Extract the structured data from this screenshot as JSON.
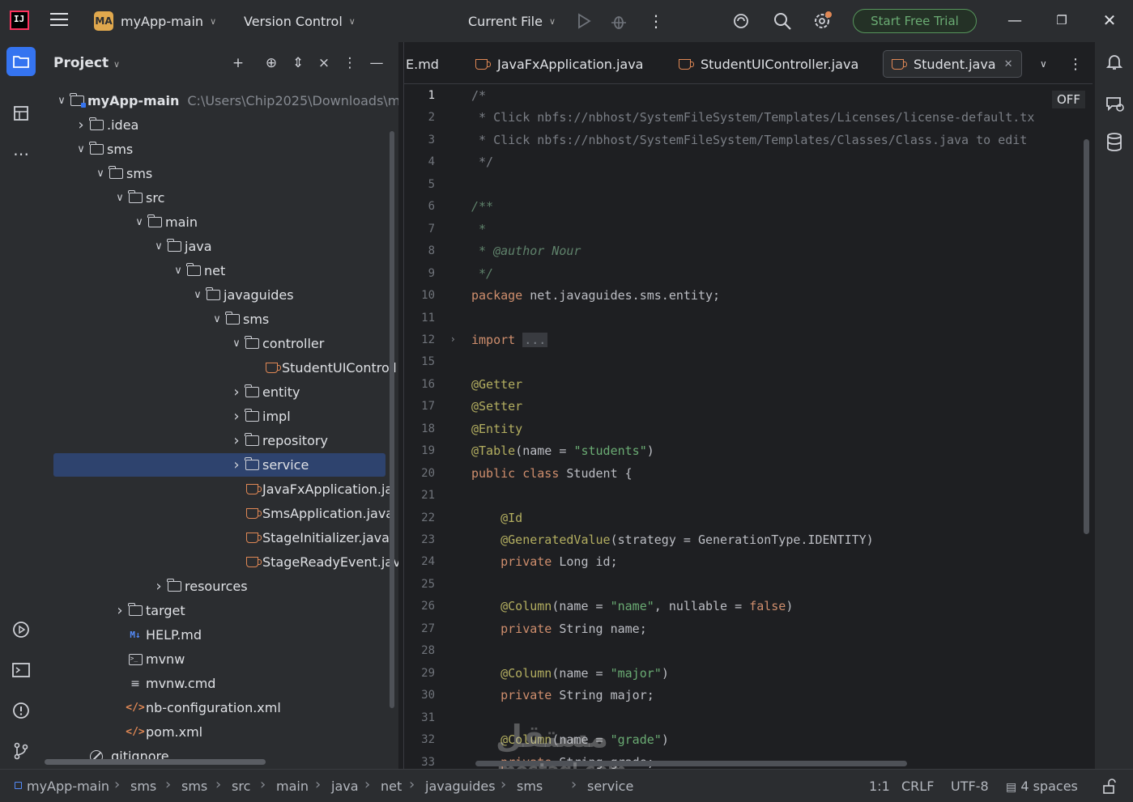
{
  "titlebar": {
    "project_badge": "MA",
    "project_name": "myApp-main",
    "vcs_label": "Version Control",
    "run_config": "Current File",
    "trial_label": "Start Free Trial"
  },
  "project_panel": {
    "title": "Project",
    "tree": [
      {
        "label": "myApp-main",
        "path": "C:\\Users\\Chip2025\\Downloads\\m",
        "depth": 0,
        "arrow": "v",
        "icon": "module-folder-icon",
        "bold": true
      },
      {
        "label": ".idea",
        "depth": 1,
        "arrow": ">",
        "icon": "folder-icon"
      },
      {
        "label": "sms",
        "depth": 1,
        "arrow": "v",
        "icon": "folder-icon"
      },
      {
        "label": "sms",
        "depth": 2,
        "arrow": "v",
        "icon": "folder-icon"
      },
      {
        "label": "src",
        "depth": 3,
        "arrow": "v",
        "icon": "folder-icon"
      },
      {
        "label": "main",
        "depth": 4,
        "arrow": "v",
        "icon": "folder-icon"
      },
      {
        "label": "java",
        "depth": 5,
        "arrow": "v",
        "icon": "folder-icon"
      },
      {
        "label": "net",
        "depth": 6,
        "arrow": "v",
        "icon": "folder-icon"
      },
      {
        "label": "javaguides",
        "depth": 7,
        "arrow": "v",
        "icon": "folder-icon"
      },
      {
        "label": "sms",
        "depth": 8,
        "arrow": "v",
        "icon": "folder-icon"
      },
      {
        "label": "controller",
        "depth": 9,
        "arrow": "v",
        "icon": "folder-icon"
      },
      {
        "label": "StudentUIControll",
        "depth": 10,
        "arrow": "",
        "icon": "java-file-icon"
      },
      {
        "label": "entity",
        "depth": 9,
        "arrow": ">",
        "icon": "folder-icon"
      },
      {
        "label": "impl",
        "depth": 9,
        "arrow": ">",
        "icon": "folder-icon"
      },
      {
        "label": "repository",
        "depth": 9,
        "arrow": ">",
        "icon": "folder-icon"
      },
      {
        "label": "service",
        "depth": 9,
        "arrow": ">",
        "icon": "folder-icon",
        "selected": true
      },
      {
        "label": "JavaFxApplication.ja",
        "depth": 9,
        "arrow": "",
        "icon": "java-file-icon"
      },
      {
        "label": "SmsApplication.java",
        "depth": 9,
        "arrow": "",
        "icon": "java-file-icon"
      },
      {
        "label": "StageInitializer.java",
        "depth": 9,
        "arrow": "",
        "icon": "java-file-icon"
      },
      {
        "label": "StageReadyEvent.jav",
        "depth": 9,
        "arrow": "",
        "icon": "java-file-icon"
      },
      {
        "label": "resources",
        "depth": 5,
        "arrow": ">",
        "icon": "folder-icon"
      },
      {
        "label": "target",
        "depth": 3,
        "arrow": ">",
        "icon": "folder-icon"
      },
      {
        "label": "HELP.md",
        "depth": 3,
        "arrow": "",
        "icon": "markdown-icon"
      },
      {
        "label": "mvnw",
        "depth": 3,
        "arrow": "",
        "icon": "terminal-file-icon"
      },
      {
        "label": "mvnw.cmd",
        "depth": 3,
        "arrow": "",
        "icon": "text-file-icon"
      },
      {
        "label": "nb-configuration.xml",
        "depth": 3,
        "arrow": "",
        "icon": "xml-file-icon"
      },
      {
        "label": "pom.xml",
        "depth": 3,
        "arrow": "",
        "icon": "xml-file-icon"
      },
      {
        "label": ".gitignore",
        "depth": 1,
        "arrow": "",
        "icon": "ignore-file-icon"
      }
    ]
  },
  "editor": {
    "tabs": [
      {
        "label": "E.md",
        "icon": ""
      },
      {
        "label": "JavaFxApplication.java",
        "icon": "java"
      },
      {
        "label": "StudentUIController.java",
        "icon": "java"
      },
      {
        "label": "Student.java",
        "icon": "java",
        "active": true
      }
    ],
    "off_badge": "OFF",
    "line_numbers": [
      "1",
      "2",
      "3",
      "4",
      "5",
      "6",
      "7",
      "8",
      "9",
      "10",
      "11",
      "12",
      "15",
      "16",
      "17",
      "18",
      "19",
      "20",
      "21",
      "22",
      "23",
      "24",
      "25",
      "26",
      "27",
      "28",
      "29",
      "30",
      "31",
      "32",
      "33"
    ],
    "code": [
      [
        {
          "t": "/*",
          "c": "cm"
        }
      ],
      [
        {
          "t": " * Click nbfs://nbhost/SystemFileSystem/Templates/Licenses/license-default.tx",
          "c": "cm"
        }
      ],
      [
        {
          "t": " * Click nbfs://nbhost/SystemFileSystem/Templates/Classes/Class.java to edit",
          "c": "cm"
        }
      ],
      [
        {
          "t": " */",
          "c": "cm"
        }
      ],
      [],
      [
        {
          "t": "/**",
          "c": "cmdoc"
        }
      ],
      [
        {
          "t": " *",
          "c": "cmdoc"
        }
      ],
      [
        {
          "t": " * @author Nour",
          "c": "cmdoc"
        }
      ],
      [
        {
          "t": " */",
          "c": "cmdoc"
        }
      ],
      [
        {
          "t": "package",
          "c": "kw"
        },
        {
          "t": " net.javaguides.sms.entity;",
          "c": ""
        }
      ],
      [],
      [
        {
          "t": "import",
          "c": "kw"
        },
        {
          "t": " ",
          "c": ""
        },
        {
          "t": "...",
          "c": "fold-box"
        }
      ],
      [],
      [
        {
          "t": "@Getter",
          "c": "an"
        }
      ],
      [
        {
          "t": "@Setter",
          "c": "an"
        }
      ],
      [
        {
          "t": "@Entity",
          "c": "an"
        }
      ],
      [
        {
          "t": "@Table",
          "c": "an"
        },
        {
          "t": "(name = ",
          "c": ""
        },
        {
          "t": "\"students\"",
          "c": "str"
        },
        {
          "t": ")",
          "c": ""
        }
      ],
      [
        {
          "t": "public class",
          "c": "kw"
        },
        {
          "t": " Student {",
          "c": ""
        }
      ],
      [],
      [
        {
          "t": "    @Id",
          "c": "an"
        }
      ],
      [
        {
          "t": "    @GeneratedValue",
          "c": "an"
        },
        {
          "t": "(strategy = GenerationType.IDENTITY)",
          "c": ""
        }
      ],
      [
        {
          "t": "    private",
          "c": "kw"
        },
        {
          "t": " Long id;",
          "c": ""
        }
      ],
      [],
      [
        {
          "t": "    @Column",
          "c": "an"
        },
        {
          "t": "(name = ",
          "c": ""
        },
        {
          "t": "\"name\"",
          "c": "str"
        },
        {
          "t": ", nullable = ",
          "c": ""
        },
        {
          "t": "false",
          "c": "kw"
        },
        {
          "t": ")",
          "c": ""
        }
      ],
      [
        {
          "t": "    private",
          "c": "kw"
        },
        {
          "t": " String name;",
          "c": ""
        }
      ],
      [],
      [
        {
          "t": "    @Column",
          "c": "an"
        },
        {
          "t": "(name = ",
          "c": ""
        },
        {
          "t": "\"major\"",
          "c": "str"
        },
        {
          "t": ")",
          "c": ""
        }
      ],
      [
        {
          "t": "    private",
          "c": "kw"
        },
        {
          "t": " String major;",
          "c": ""
        }
      ],
      [],
      [
        {
          "t": "    @Column",
          "c": "an"
        },
        {
          "t": "(name = ",
          "c": ""
        },
        {
          "t": "\"grade\"",
          "c": "str"
        },
        {
          "t": ")",
          "c": ""
        }
      ],
      [
        {
          "t": "    private",
          "c": "kw"
        },
        {
          "t": " String grade;",
          "c": ""
        }
      ]
    ]
  },
  "statusbar": {
    "breadcrumbs": [
      "myApp-main",
      "sms",
      "sms",
      "src",
      "main",
      "java",
      "net",
      "javaguides",
      "sms",
      "service"
    ],
    "caret": "1:1",
    "line_sep": "CRLF",
    "encoding": "UTF-8",
    "indent": "4 spaces"
  },
  "watermark": {
    "line1": "مستقل",
    "line2": "mostaql.com"
  },
  "colors": {
    "accent": "#3574f0",
    "selection": "#2e436e",
    "trial_green": "#57965c",
    "keyword": "#cf8e6d",
    "annotation": "#b3ae60",
    "string": "#6aab73",
    "comment": "#7a7e85",
    "doc_comment": "#5f826b"
  }
}
